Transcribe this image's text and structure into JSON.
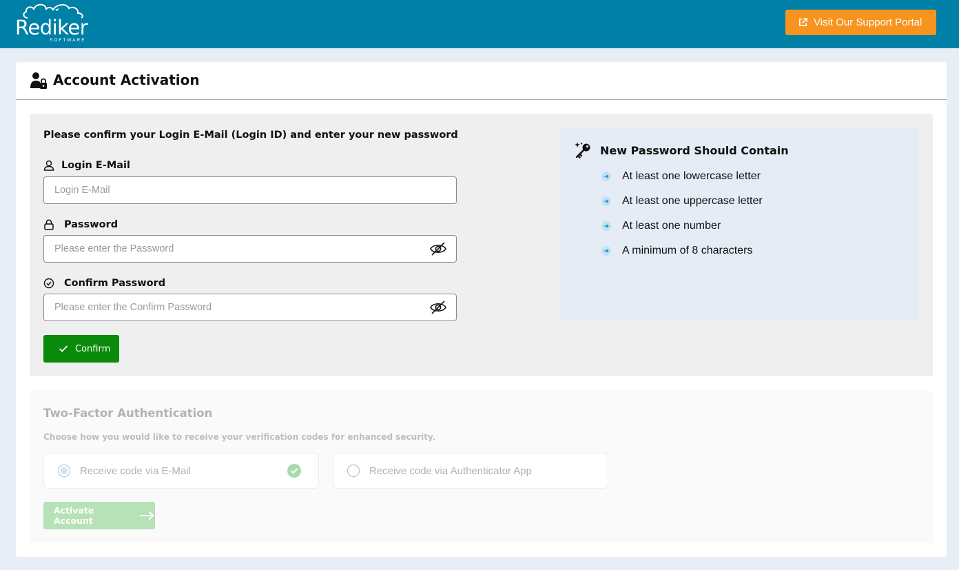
{
  "header": {
    "logo_text": "Rediker",
    "logo_subtext": "SOFTWARE",
    "support_button": "Visit Our Support Portal",
    "colors": {
      "bar": "#0080a6",
      "support_button": "#f7941d"
    }
  },
  "page": {
    "title": "Account Activation",
    "title_icon": "user-lock-icon"
  },
  "form": {
    "instruction": "Please confirm your Login E-Mail (Login ID) and enter your new password",
    "email_label": "Login E-Mail",
    "email_placeholder": "Login E-Mail",
    "email_value": "",
    "password_label": "Password",
    "password_placeholder": "Please enter the Password",
    "confirm_label": "Confirm Password",
    "confirm_placeholder": "Please enter the Confirm Password",
    "confirm_button": "Confirm",
    "confirm_button_color": "#0a8a0a"
  },
  "rules": {
    "title": "New Password Should Contain",
    "items": [
      "At least one lowercase letter",
      "At least one uppercase letter",
      "At least one number",
      "A minimum of 8 characters"
    ]
  },
  "two_factor": {
    "title": "Two-Factor Authentication",
    "description": "Choose how you would like to receive your verification codes for enhanced security.",
    "options": [
      {
        "label": "Receive code via E-Mail",
        "selected": true
      },
      {
        "label": "Receive code via Authenticator App",
        "selected": false
      }
    ],
    "activate_button": "Activate Account",
    "disabled": true
  }
}
